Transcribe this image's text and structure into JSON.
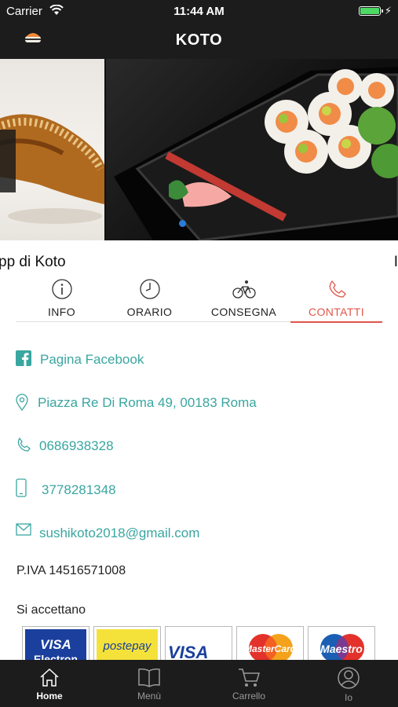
{
  "status_bar": {
    "carrier": "Carrier",
    "time": "11:44 AM"
  },
  "header": {
    "title": "KOTO"
  },
  "hero": {
    "caption_left": "pp di Koto",
    "caption_right": "I"
  },
  "tabs": [
    {
      "label": "INFO",
      "icon": "info-icon"
    },
    {
      "label": "ORARIO",
      "icon": "clock-icon"
    },
    {
      "label": "CONSEGNA",
      "icon": "bicycle-icon"
    },
    {
      "label": "CONTATTI",
      "icon": "phone-icon",
      "active": true
    }
  ],
  "contacts": {
    "facebook": "Pagina Facebook",
    "address": "Piazza Re Di Roma 49, 00183 Roma",
    "phone": "0686938328",
    "mobile": "3778281348",
    "email": "sushikoto2018@gmail.com"
  },
  "piva": "P.IVA 14516571008",
  "accept_label": "Si accettano",
  "payment_cards": [
    {
      "brand": "VISA",
      "sub": "Electron"
    },
    {
      "brand": "postepay"
    },
    {
      "brand": "VISA"
    },
    {
      "brand": "MasterCard"
    },
    {
      "brand": "Maestro"
    }
  ],
  "tabbar": [
    {
      "label": "Home",
      "icon": "home-icon",
      "active": true
    },
    {
      "label": "Menù",
      "icon": "book-icon"
    },
    {
      "label": "Carrello",
      "icon": "cart-icon"
    },
    {
      "label": "Io",
      "icon": "user-icon"
    }
  ],
  "colors": {
    "header_bg": "#1c1c1c",
    "accent_red": "#e0564a",
    "link_teal": "#3aa6a0",
    "carousel_dot": "#2b7bd8"
  }
}
